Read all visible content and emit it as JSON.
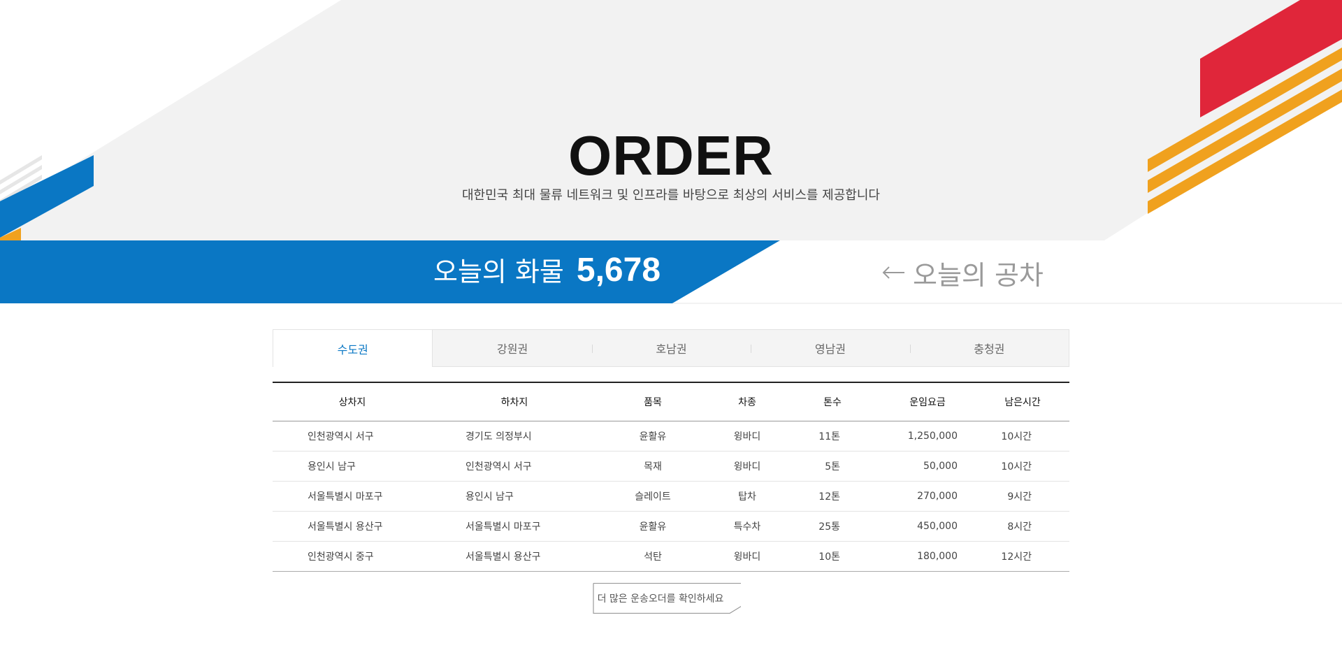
{
  "header": {
    "title": "ORDER",
    "subtitle": "대한민국 최대 물류 네트워크 및 인프라를 바탕으로 최상의 서비스를 제공합니다"
  },
  "banner": {
    "cargo_label": "오늘의 화물",
    "cargo_count": "5,678",
    "empty_truck_label": "오늘의 공차",
    "arrow_icon": "arrow-left-icon"
  },
  "tabs": [
    {
      "label": "수도권",
      "active": true
    },
    {
      "label": "강원권",
      "active": false
    },
    {
      "label": "호남권",
      "active": false
    },
    {
      "label": "영남권",
      "active": false
    },
    {
      "label": "충청권",
      "active": false
    }
  ],
  "table": {
    "columns": [
      "상차지",
      "하차지",
      "품목",
      "차종",
      "톤수",
      "운임요금",
      "남은시간"
    ],
    "rows": [
      [
        "인천광역시 서구",
        "경기도 의정부시",
        "윤활유",
        "윙바디",
        "11톤",
        "1,250,000",
        "10시간"
      ],
      [
        "용인시 남구",
        "인천광역시 서구",
        "목재",
        "윙바디",
        "5톤",
        "50,000",
        "10시간"
      ],
      [
        "서울특별시 마포구",
        "용인시 남구",
        "슬레이트",
        "탑차",
        "12톤",
        "270,000",
        "9시간"
      ],
      [
        "서울특별시 용산구",
        "서울특별시 마포구",
        "윤활유",
        "특수차",
        "25통",
        "450,000",
        "8시간"
      ],
      [
        "인천광역시 중구",
        "서울특별시 용산구",
        "석탄",
        "윙바디",
        "10톤",
        "180,000",
        "12시간"
      ]
    ]
  },
  "more_button": {
    "label": "더 많은 운송오더를 확인하세요"
  },
  "colors": {
    "accent_blue": "#0a77c4",
    "accent_red": "#e0263a",
    "accent_orange": "#f0a11e",
    "bg_gray": "#f2f2f2"
  }
}
